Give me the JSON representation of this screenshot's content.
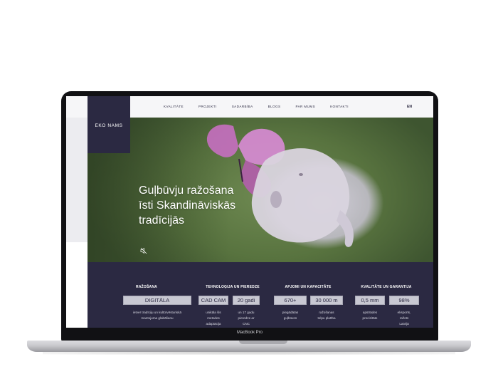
{
  "device": {
    "model_label": "MacBook Pro"
  },
  "site": {
    "logo": "EKO NAMS",
    "nav": [
      "KVALITĀTE",
      "PROJEKTI",
      "SADARBĪBA",
      "BLOGS",
      "PAR MUMS",
      "KONTAKTI"
    ],
    "language": "EN",
    "hero": {
      "title_lines": [
        "Guļbūvju ražošana",
        "īsti Skandināviskās",
        "tradīcijās"
      ]
    },
    "stats": [
      {
        "title": "RAŽOŠANA",
        "boxes": [
          "DIGITĀLA"
        ],
        "descriptions": [
          [
            "ietver tradīciju un kultūrvēsturiskā",
            "mantojuma glabāšanu"
          ]
        ]
      },
      {
        "title": "TEHNOLOĢIJA UN PIEREDZE",
        "boxes": [
          "CAD CAM",
          "20 gadi"
        ],
        "descriptions": [
          [
            "unikāla šis",
            "metodes",
            "adaptācija"
          ],
          [
            "un 17 gadu",
            "pieredze ar",
            "CNC"
          ]
        ]
      },
      {
        "title": "APJOMI UN KAPACITĀTE",
        "boxes": [
          "670+",
          "30 000 m"
        ],
        "descriptions": [
          [
            "piegādātas",
            "guļbūves"
          ],
          [
            "ražošanas",
            "telpu platība"
          ]
        ]
      },
      {
        "title": "KVALITĀTE UN GARANTIJA",
        "boxes": [
          "0,5 mm",
          "98%"
        ],
        "descriptions": [
          [
            "apstrādes",
            "precizitāte"
          ],
          [
            "eksports,",
            "ražots",
            "Latvijā"
          ]
        ]
      }
    ]
  }
}
